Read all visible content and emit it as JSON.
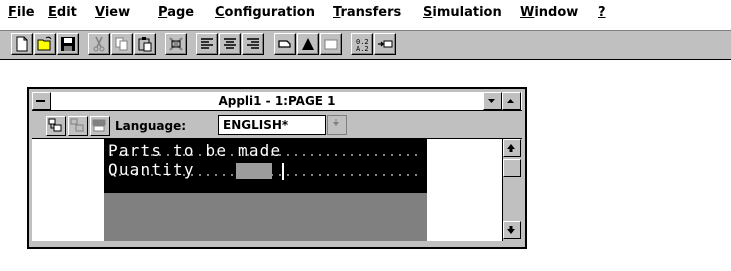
{
  "menu": {
    "items": [
      {
        "first": "F",
        "rest": "ile"
      },
      {
        "first": "E",
        "rest": "dit"
      },
      {
        "first": "V",
        "rest": "iew"
      },
      {
        "first": "P",
        "rest": "age"
      },
      {
        "first": "C",
        "rest": "onfiguration"
      },
      {
        "first": "T",
        "rest": "ransfers"
      },
      {
        "first": "S",
        "rest": "imulation"
      },
      {
        "first": "W",
        "rest": "indow"
      },
      {
        "first": "?",
        "rest": ""
      }
    ]
  },
  "toolbar": {
    "icons": [
      "new-icon",
      "open-icon",
      "save-icon",
      "cut-icon",
      "copy-icon",
      "paste-icon",
      "delete-icon",
      "align-left-icon",
      "align-center-icon",
      "align-right-icon",
      "frame-icon",
      "triangle-icon",
      "grayed-box-icon",
      "numbers-icon",
      "arrow-box-icon"
    ]
  },
  "window": {
    "title": "Appli1 - 1:PAGE 1",
    "language_label": "Language:",
    "language_value": "ENGLISH*"
  },
  "screen": {
    "line1": "Parts to be made",
    "line2": "Quantity"
  },
  "colors": {
    "toolbar_bg": "#c0c0c0",
    "terminal_bg": "#000000",
    "terminal_text": "#ffffff",
    "field_bg": "#9c9c9c"
  }
}
